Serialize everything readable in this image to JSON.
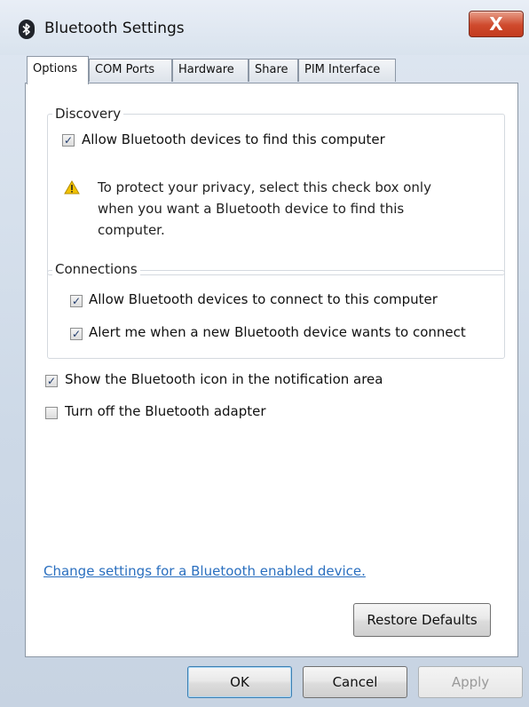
{
  "window": {
    "title": "Bluetooth Settings",
    "close_glyph": "X",
    "accent_close": "#c33b1f"
  },
  "tabs": [
    {
      "label": "Options",
      "active": true
    },
    {
      "label": "COM Ports",
      "active": false
    },
    {
      "label": "Hardware",
      "active": false
    },
    {
      "label": "Share",
      "active": false
    },
    {
      "label": "PIM Interface",
      "active": false
    }
  ],
  "discovery": {
    "legend": "Discovery",
    "allow_find": {
      "label": "Allow Bluetooth devices to find this computer",
      "checked": true
    },
    "warning_icon": "warning-icon",
    "privacy_note": "To protect your privacy, select this check box only when you want a Bluetooth device to find this computer."
  },
  "connections": {
    "legend": "Connections",
    "allow_connect": {
      "label": "Allow Bluetooth devices to connect to this computer",
      "checked": true
    },
    "alert_new": {
      "label": "Alert me when a new Bluetooth device wants to connect",
      "checked": true
    }
  },
  "options": {
    "show_icon": {
      "label": "Show the Bluetooth icon in the notification area",
      "checked": true
    },
    "turn_off": {
      "label": "Turn off the Bluetooth adapter",
      "checked": false
    }
  },
  "link": {
    "text": "Change settings for a Bluetooth enabled device."
  },
  "buttons": {
    "restore_defaults": "Restore Defaults",
    "ok": "OK",
    "cancel": "Cancel",
    "apply": "Apply"
  },
  "check_glyph": "✓"
}
